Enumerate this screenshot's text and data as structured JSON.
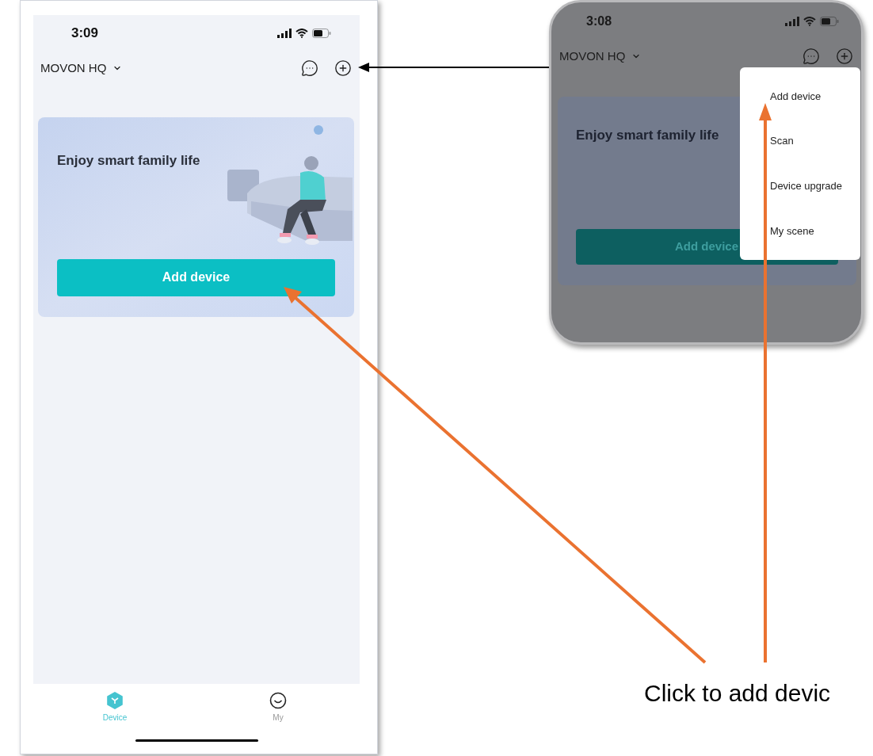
{
  "main_screen": {
    "status_bar": {
      "time": "3:09"
    },
    "header": {
      "title": "MOVON HQ"
    },
    "banner": {
      "title": "Enjoy smart family life",
      "button": "Add device"
    },
    "tab_bar": [
      {
        "label": "Device",
        "selected": true
      },
      {
        "label": "My",
        "selected": false
      }
    ]
  },
  "menu_screen": {
    "status_bar": {
      "time": "3:08"
    },
    "header": {
      "title": "MOVON HQ"
    },
    "banner": {
      "title": "Enjoy smart family life",
      "button": "Add device"
    },
    "menu": [
      {
        "label": "Add device"
      },
      {
        "label": "Scan"
      },
      {
        "label": "Device upgrade"
      },
      {
        "label": "My scene"
      }
    ]
  },
  "caption": "Click to add devic"
}
